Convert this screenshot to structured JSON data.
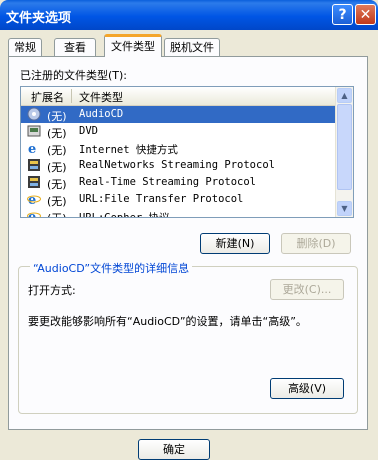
{
  "window": {
    "title": "文件夹选项",
    "help_btn": "?",
    "close_btn": "✕"
  },
  "tabs": [
    {
      "label": "常规"
    },
    {
      "label": "查看"
    },
    {
      "label": "文件类型",
      "active": true
    },
    {
      "label": "脱机文件"
    }
  ],
  "registered_label": "已注册的文件类型(T):",
  "list": {
    "columns": [
      "扩展名",
      "文件类型"
    ],
    "rows": [
      {
        "ext": "(无)",
        "type": "AudioCD",
        "icon": "audiocd-icon",
        "selected": true
      },
      {
        "ext": "(无)",
        "type": "DVD",
        "icon": "dvd-icon"
      },
      {
        "ext": "(无)",
        "type": "Internet 快捷方式",
        "icon": "internet-shortcut-icon"
      },
      {
        "ext": "(无)",
        "type": "RealNetworks Streaming Protocol",
        "icon": "film-icon"
      },
      {
        "ext": "(无)",
        "type": "Real-Time Streaming Protocol",
        "icon": "film-icon"
      },
      {
        "ext": "(无)",
        "type": "URL:File Transfer Protocol",
        "icon": "ie-icon"
      },
      {
        "ext": "(无)",
        "type": "URL:Gopher 协议",
        "icon": "ie-icon"
      }
    ]
  },
  "buttons": {
    "new": "新建(N)",
    "delete": "删除(D)",
    "change": "更改(C)...",
    "advanced": "高级(V)",
    "ok": "确定"
  },
  "details": {
    "title": "“AudioCD”文件类型的详细信息",
    "open_with_label": "打开方式:",
    "description": "要更改能够影响所有“AudioCD”的设置，请单击“高级”。"
  },
  "colors": {
    "selection": "#316AC5",
    "titlebar": "#0055E5",
    "tab_highlight": "#F4A52A"
  }
}
